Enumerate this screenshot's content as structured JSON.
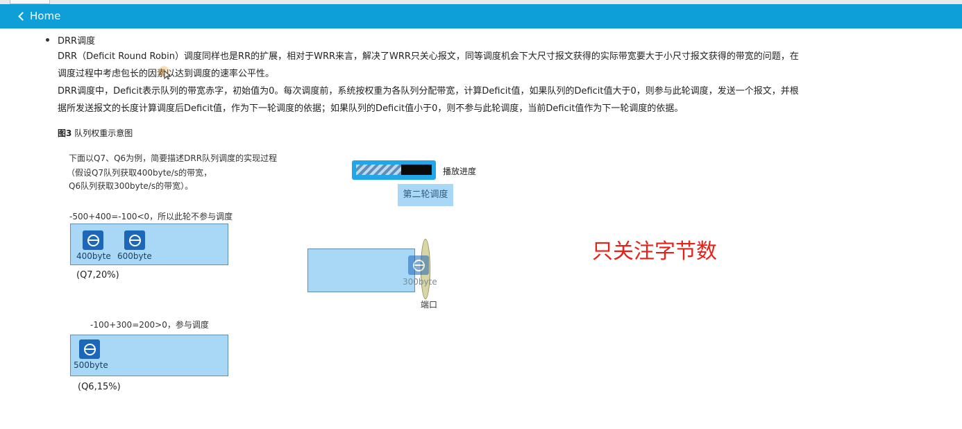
{
  "nav": {
    "back_label": "Home"
  },
  "section": {
    "heading": "DRR调度",
    "para1_line1": "DRR（Deficit Round Robin）调度同样也是RR的扩展，相对于WRR来言，解决了WRR只关心报文，同等调度机会下大尺寸报文获得的实际带宽要大于小尺寸报文获得的带宽的问题，在",
    "para1_line2": "调度过程中考虑包长的因素以达到调度的速率公平性。",
    "para2_line1": "DRR调度中，Deficit表示队列的带宽赤字，初始值为0。每次调度前，系统按权重为各队列分配带宽，计算Deficit值，如果队列的Deficit值大于0，则参与此轮调度，发送一个报文，并根",
    "para2_line2": "据所发送报文的长度计算调度后Deficit值，作为下一轮调度的依据；如果队列的Deficit值小于0，则不参与此轮调度，当前Deficit值作为下一轮调度的依据。"
  },
  "figure": {
    "caption_num": "图3",
    "caption_text": "队列权重示意图",
    "intro_line1": "下面以Q7、Q6为例，简要描述DRR队列调度的实现过程",
    "intro_line2": "（假设Q7队列获取400byte/s的带宽，",
    "intro_line3": "Q6队列获取300byte/s的带宽）。",
    "q7": {
      "calc": "-500+400=-100<0，所以此轮不参与调度",
      "packets": [
        "400byte",
        "600byte"
      ],
      "label": "(Q7,20%)"
    },
    "q6": {
      "calc": "-100+300=200>0，参与调度",
      "packets": [
        "500byte"
      ],
      "label": "(Q6,15%)"
    },
    "port": {
      "packet": "300byte",
      "label": "端口"
    },
    "progress": {
      "label": "播放进度",
      "value": 0.6
    },
    "round_badge": "第二轮调度"
  },
  "annotation": {
    "text": "只关注字节数",
    "color": "#e8201a"
  },
  "colors": {
    "topbar": "#0e9fd8",
    "queue_fill": "#a9d8f6",
    "packet": "#1c67b7"
  }
}
